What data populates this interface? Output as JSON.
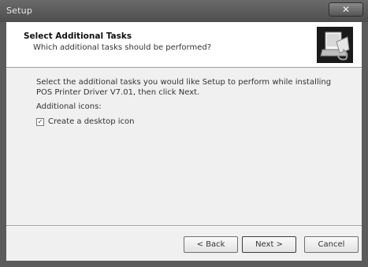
{
  "window": {
    "title": "Setup",
    "close_label": "✕"
  },
  "header": {
    "title": "Select Additional Tasks",
    "subtitle": "Which additional tasks should be performed?",
    "icon": "setup-computer-icon"
  },
  "body": {
    "instruction": "Select the additional tasks you would like Setup to perform while installing POS Printer Driver V7.01, then click Next.",
    "group_label": "Additional icons:",
    "tasks": [
      {
        "label": "Create a desktop icon",
        "checked": true
      }
    ]
  },
  "buttons": {
    "back": "< Back",
    "next": "Next >",
    "cancel": "Cancel"
  }
}
